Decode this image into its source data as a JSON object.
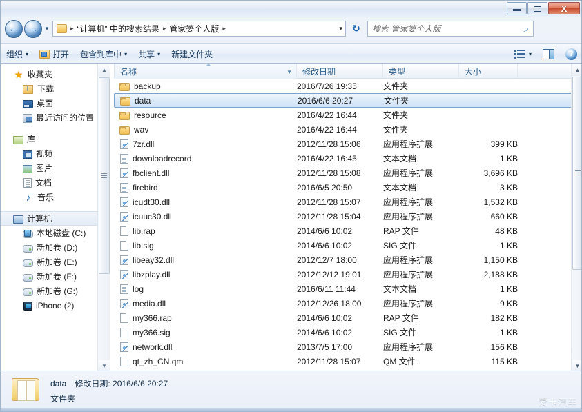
{
  "window": {
    "minimize_label": "最小化",
    "maximize_label": "最大化",
    "close_label": "X"
  },
  "address_bar": {
    "back_glyph": "←",
    "forward_glyph": "→",
    "history_glyph": "▾",
    "crumbs": [
      "“计算机” 中的搜索结果",
      "管家婆个人版"
    ],
    "separator": "▸",
    "dropdown_glyph": "▾",
    "refresh_glyph": "↻",
    "search_placeholder": "搜索 管家婆个人版",
    "search_icon_glyph": "⌕"
  },
  "toolbar": {
    "organize_label": "组织",
    "open_label": "打开",
    "include_library_label": "包含到库中",
    "share_label": "共享",
    "new_folder_label": "新建文件夹",
    "caret_glyph": "▾",
    "help_glyph": "?"
  },
  "sidebar": {
    "groups": [
      {
        "header": "收藏夹",
        "header_icon": "star-icon",
        "items": [
          {
            "label": "下载",
            "icon": "download-folder-icon"
          },
          {
            "label": "桌面",
            "icon": "desktop-icon"
          },
          {
            "label": "最近访问的位置",
            "icon": "recent-places-icon"
          }
        ]
      },
      {
        "header": "库",
        "header_icon": "library-icon",
        "items": [
          {
            "label": "视频",
            "icon": "video-icon"
          },
          {
            "label": "图片",
            "icon": "picture-icon"
          },
          {
            "label": "文档",
            "icon": "document-icon"
          },
          {
            "label": "音乐",
            "icon": "music-icon"
          }
        ]
      },
      {
        "header": "计算机",
        "header_icon": "computer-icon",
        "selected": true,
        "items": [
          {
            "label": "本地磁盘 (C:)",
            "icon": "system-drive-icon"
          },
          {
            "label": "新加卷 (D:)",
            "icon": "drive-icon"
          },
          {
            "label": "新加卷 (E:)",
            "icon": "drive-icon"
          },
          {
            "label": "新加卷 (F:)",
            "icon": "drive-icon"
          },
          {
            "label": "新加卷 (G:)",
            "icon": "drive-icon"
          },
          {
            "label": "iPhone (2)",
            "icon": "iphone-icon"
          }
        ]
      }
    ]
  },
  "file_list": {
    "columns": [
      {
        "label": "名称",
        "sorted": true
      },
      {
        "label": "修改日期",
        "sorted": false
      },
      {
        "label": "类型",
        "sorted": false
      },
      {
        "label": "大小",
        "sorted": false
      }
    ],
    "rows": [
      {
        "name": "backup",
        "date": "2016/7/26 19:35",
        "type": "文件夹",
        "size": "",
        "icon": "folder-icon",
        "selected": false
      },
      {
        "name": "data",
        "date": "2016/6/6 20:27",
        "type": "文件夹",
        "size": "",
        "icon": "folder-icon",
        "selected": true
      },
      {
        "name": "resource",
        "date": "2016/4/22 16:44",
        "type": "文件夹",
        "size": "",
        "icon": "folder-icon",
        "selected": false
      },
      {
        "name": "wav",
        "date": "2016/4/22 16:44",
        "type": "文件夹",
        "size": "",
        "icon": "folder-icon",
        "selected": false
      },
      {
        "name": "7zr.dll",
        "date": "2012/11/28 15:06",
        "type": "应用程序扩展",
        "size": "399 KB",
        "icon": "dll-icon",
        "selected": false
      },
      {
        "name": "downloadrecord",
        "date": "2016/4/22 16:45",
        "type": "文本文档",
        "size": "1 KB",
        "icon": "text-icon",
        "selected": false
      },
      {
        "name": "fbclient.dll",
        "date": "2012/11/28 15:08",
        "type": "应用程序扩展",
        "size": "3,696 KB",
        "icon": "dll-icon",
        "selected": false
      },
      {
        "name": "firebird",
        "date": "2016/6/5 20:50",
        "type": "文本文档",
        "size": "3 KB",
        "icon": "text-icon",
        "selected": false
      },
      {
        "name": "icudt30.dll",
        "date": "2012/11/28 15:07",
        "type": "应用程序扩展",
        "size": "1,532 KB",
        "icon": "dll-icon",
        "selected": false
      },
      {
        "name": "icuuc30.dll",
        "date": "2012/11/28 15:04",
        "type": "应用程序扩展",
        "size": "660 KB",
        "icon": "dll-icon",
        "selected": false
      },
      {
        "name": "lib.rap",
        "date": "2014/6/6 10:02",
        "type": "RAP 文件",
        "size": "48 KB",
        "icon": "plain-file-icon",
        "selected": false
      },
      {
        "name": "lib.sig",
        "date": "2014/6/6 10:02",
        "type": "SIG 文件",
        "size": "1 KB",
        "icon": "plain-file-icon",
        "selected": false
      },
      {
        "name": "libeay32.dll",
        "date": "2012/12/7 18:00",
        "type": "应用程序扩展",
        "size": "1,150 KB",
        "icon": "dll-icon",
        "selected": false
      },
      {
        "name": "libzplay.dll",
        "date": "2012/12/12 19:01",
        "type": "应用程序扩展",
        "size": "2,188 KB",
        "icon": "dll-icon",
        "selected": false
      },
      {
        "name": "log",
        "date": "2016/6/11 11:44",
        "type": "文本文档",
        "size": "1 KB",
        "icon": "text-icon",
        "selected": false
      },
      {
        "name": "media.dll",
        "date": "2012/12/26 18:00",
        "type": "应用程序扩展",
        "size": "9 KB",
        "icon": "dll-icon",
        "selected": false
      },
      {
        "name": "my366.rap",
        "date": "2014/6/6 10:02",
        "type": "RAP 文件",
        "size": "182 KB",
        "icon": "plain-file-icon",
        "selected": false
      },
      {
        "name": "my366.sig",
        "date": "2014/6/6 10:02",
        "type": "SIG 文件",
        "size": "1 KB",
        "icon": "plain-file-icon",
        "selected": false
      },
      {
        "name": "network.dll",
        "date": "2013/7/5 17:00",
        "type": "应用程序扩展",
        "size": "156 KB",
        "icon": "dll-icon",
        "selected": false
      },
      {
        "name": "qt_zh_CN.qm",
        "date": "2012/11/28 15:07",
        "type": "QM 文件",
        "size": "115 KB",
        "icon": "plain-file-icon",
        "selected": false
      }
    ]
  },
  "details_pane": {
    "name": "data",
    "date_label": "修改日期:",
    "date_value": "2016/6/6 20:27",
    "type": "文件夹"
  },
  "watermark": "爱卡汽车",
  "colors": {
    "selection_border": "#7da2ce",
    "header_text": "#2b5d8b",
    "folder_yellow": "#f9d277",
    "close_button_red": "#c64a2d"
  }
}
